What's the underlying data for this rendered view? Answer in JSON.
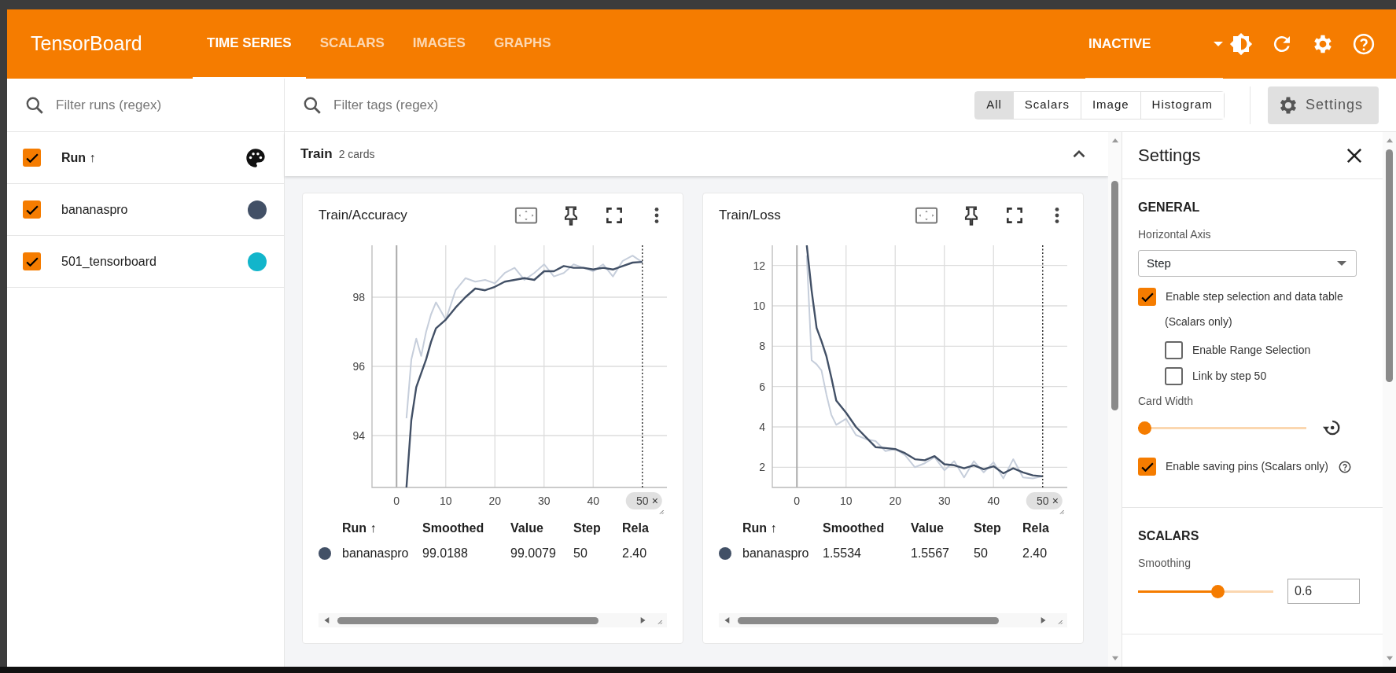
{
  "header": {
    "logo": "TensorBoard",
    "tabs": [
      {
        "label": "TIME SERIES",
        "selected": true
      },
      {
        "label": "SCALARS",
        "selected": false
      },
      {
        "label": "IMAGES",
        "selected": false
      },
      {
        "label": "GRAPHS",
        "selected": false
      }
    ],
    "run_state": "INACTIVE"
  },
  "runs_panel": {
    "filter_placeholder": "Filter runs (regex)",
    "header": {
      "label": "Run ↑",
      "checked": true
    },
    "runs": [
      {
        "name": "bananaspro",
        "checked": true,
        "color": "#425066"
      },
      {
        "name": "501_tensorboard",
        "checked": true,
        "color": "#12b5cb"
      }
    ]
  },
  "toolbar": {
    "filter_placeholder": "Filter tags (regex)",
    "type_filters": [
      {
        "label": "All",
        "selected": true
      },
      {
        "label": "Scalars",
        "selected": false
      },
      {
        "label": "Image",
        "selected": false
      },
      {
        "label": "Histogram",
        "selected": false
      }
    ],
    "settings_button": "Settings"
  },
  "group": {
    "title": "Train",
    "count": "2 cards",
    "expanded": true
  },
  "cards": [
    {
      "title": "Train/Accuracy",
      "chip_close": "×",
      "table": {
        "columns": [
          "Run ↑",
          "Smoothed",
          "Value",
          "Step",
          "Rela"
        ],
        "rows": [
          {
            "color": "#425066",
            "cells": [
              "bananaspro",
              "99.0188",
              "99.0079",
              "50",
              "2.40"
            ]
          }
        ]
      },
      "chart_data": {
        "type": "line",
        "x": [
          2,
          3,
          4,
          5,
          6,
          7,
          8,
          10,
          12,
          14,
          16,
          18,
          20,
          22,
          24,
          26,
          28,
          30,
          32,
          34,
          36,
          38,
          40,
          42,
          44,
          46,
          48,
          50
        ],
        "series": [
          {
            "color": "#425066",
            "values": [
              92.5,
              94.45,
              95.4,
              95.8,
              96.2,
              96.7,
              97.1,
              97.35,
              97.7,
              98.0,
              98.25,
              98.2,
              98.3,
              98.45,
              98.5,
              98.55,
              98.5,
              98.75,
              98.75,
              98.9,
              98.85,
              98.85,
              98.8,
              98.85,
              98.8,
              98.9,
              99.0,
              99.02
            ]
          },
          {
            "color": "#c6cedb",
            "values": [
              94.5,
              96.2,
              96.8,
              96.3,
              97.0,
              97.5,
              97.85,
              97.35,
              98.2,
              98.55,
              98.45,
              98.5,
              98.4,
              98.7,
              98.85,
              98.5,
              98.7,
              98.95,
              98.6,
              98.7,
              98.95,
              98.85,
              98.75,
              98.95,
              98.6,
              99.05,
              99.2,
              99.01
            ]
          }
        ],
        "xlim": [
          -5,
          55
        ],
        "ylim": [
          92.5,
          99.5
        ],
        "xticks": [
          0,
          10,
          20,
          30,
          40,
          {
            "value": 50,
            "label": "50"
          }
        ],
        "yticks": [
          94,
          96,
          98
        ],
        "grid": true,
        "ref_lines": [
          {
            "axis": "x",
            "value": 50
          }
        ]
      }
    },
    {
      "title": "Train/Loss",
      "chip_close": "×",
      "table": {
        "columns": [
          "Run ↑",
          "Smoothed",
          "Value",
          "Step",
          "Rela"
        ],
        "rows": [
          {
            "color": "#425066",
            "cells": [
              "bananaspro",
              "1.5534",
              "1.5567",
              "50",
              "2.40"
            ]
          }
        ]
      },
      "chart_data": {
        "type": "line",
        "x": [
          2,
          3,
          4,
          5,
          6,
          7,
          8,
          10,
          12,
          14,
          16,
          18,
          20,
          22,
          24,
          26,
          28,
          30,
          32,
          34,
          36,
          38,
          40,
          42,
          44,
          46,
          48,
          50
        ],
        "series": [
          {
            "color": "#425066",
            "values": [
              13,
              10.75,
              8.9,
              8.25,
              7.5,
              6.45,
              5.3,
              4.7,
              4.0,
              3.5,
              3.0,
              2.95,
              2.9,
              2.7,
              2.4,
              2.35,
              2.55,
              2.15,
              2.1,
              1.95,
              2.1,
              1.9,
              2.05,
              1.7,
              1.95,
              1.75,
              1.6,
              1.55
            ]
          },
          {
            "color": "#c6cedb",
            "values": [
              12.5,
              7.3,
              7.1,
              6.8,
              5.6,
              4.6,
              4.1,
              4.4,
              3.6,
              3.4,
              3.3,
              2.8,
              2.9,
              2.6,
              2.0,
              2.2,
              2.5,
              1.85,
              2.3,
              1.5,
              2.3,
              1.75,
              2.25,
              1.45,
              2.4,
              1.5,
              1.45,
              1.56
            ]
          }
        ],
        "xlim": [
          -5,
          55
        ],
        "ylim": [
          1,
          13
        ],
        "xticks": [
          0,
          10,
          20,
          30,
          40,
          {
            "value": 50,
            "label": "50"
          }
        ],
        "yticks": [
          2,
          4,
          6,
          8,
          10,
          12
        ],
        "grid": true,
        "ref_lines": [
          {
            "axis": "x",
            "value": 50
          }
        ]
      }
    }
  ],
  "settings": {
    "title": "Settings",
    "sections": [
      {
        "heading": "GENERAL",
        "items": [
          {
            "kind": "label",
            "text": "Horizontal Axis"
          },
          {
            "kind": "select",
            "value": "Step"
          },
          {
            "kind": "checkbox",
            "label": "Enable step selection and data table",
            "note": "(Scalars only)",
            "checked": true,
            "children": [
              {
                "kind": "checkbox",
                "label": "Enable Range Selection",
                "checked": false
              },
              {
                "kind": "checkbox",
                "label": "Link by step 50",
                "checked": false
              }
            ]
          },
          {
            "kind": "label",
            "text": "Card Width"
          },
          {
            "kind": "slider",
            "level": 0,
            "reset": true
          },
          {
            "kind": "checkbox",
            "label": "Enable saving pins (Scalars only)",
            "checked": true,
            "help": true
          }
        ]
      },
      {
        "heading": "SCALARS",
        "items": [
          {
            "kind": "label",
            "text": "Smoothing"
          },
          {
            "kind": "slider",
            "level": 0.6,
            "value": "0.6"
          }
        ]
      }
    ]
  }
}
